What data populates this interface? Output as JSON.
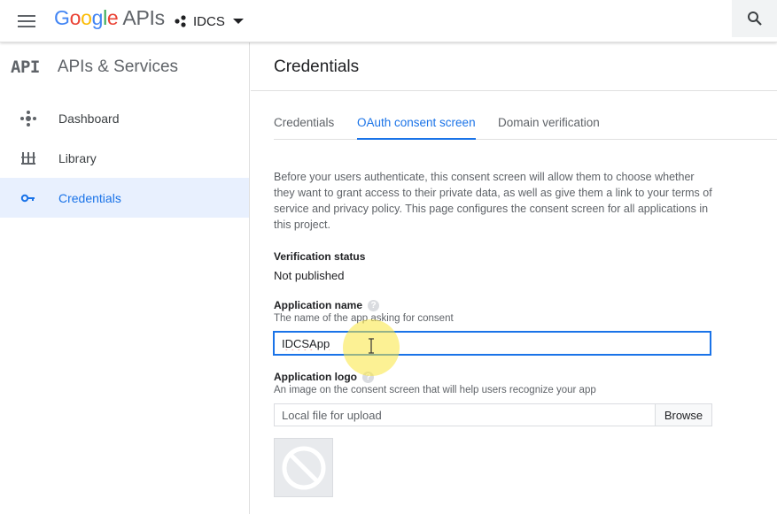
{
  "header": {
    "logo_google": [
      "G",
      "o",
      "o",
      "g",
      "l",
      "e"
    ],
    "logo_apis": "APIs",
    "project_name": "IDCS",
    "icons": {
      "menu": "hamburger-menu-icon",
      "project": "project-dots-icon",
      "dropdown": "caret-down-icon",
      "search": "search-icon"
    }
  },
  "sidebar": {
    "badge": "API",
    "title": "APIs & Services",
    "items": [
      {
        "label": "Dashboard",
        "icon": "dashboard-icon"
      },
      {
        "label": "Library",
        "icon": "library-icon"
      },
      {
        "label": "Credentials",
        "icon": "key-icon",
        "active": true
      }
    ]
  },
  "main": {
    "title": "Credentials",
    "tabs": [
      {
        "label": "Credentials"
      },
      {
        "label": "OAuth consent screen",
        "active": true
      },
      {
        "label": "Domain verification"
      }
    ],
    "description": "Before your users authenticate, this consent screen will allow them to choose whether they want to grant access to their private data, as well as give them a link to your terms of service and privacy policy. This page configures the consent screen for all applications in this project.",
    "verification": {
      "label": "Verification status",
      "value": "Not published"
    },
    "app_name": {
      "label": "Application name",
      "hint": "The name of the app asking for consent",
      "value": "IDCSApp"
    },
    "app_logo": {
      "label": "Application logo",
      "hint": "An image on the consent screen that will help users recognize your app",
      "placeholder": "Local file for upload",
      "browse_label": "Browse"
    }
  },
  "colors": {
    "accent": "#1a73e8",
    "cursor_highlight": "#fae63c"
  }
}
